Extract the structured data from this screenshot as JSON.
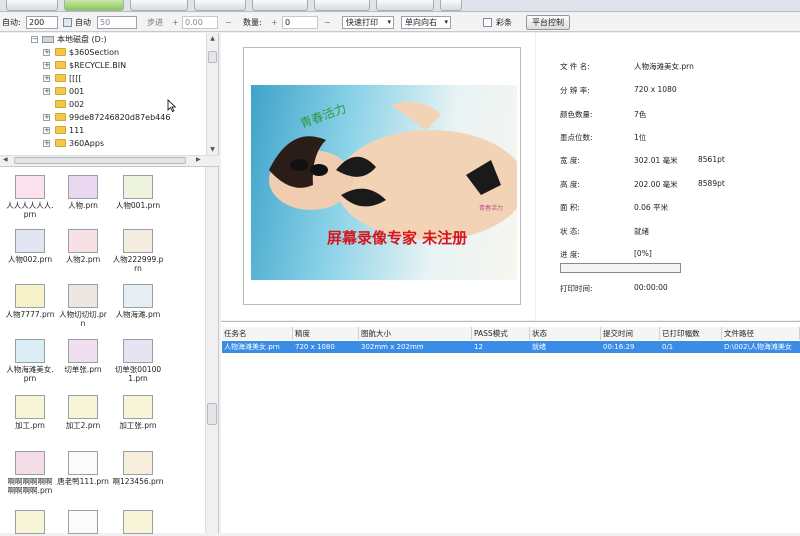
{
  "options": {
    "auto_label": "自动:",
    "auto_value": "200",
    "auto2_label": "自动",
    "auto2_value": "50",
    "spacing_label": "步进",
    "spacing_value": "0.00",
    "copies_label": "数量:",
    "copies_value": "0",
    "speed_select": "快速打印",
    "direction_select": "单向向右",
    "color_label": "彩条",
    "platform_button": "平台控制"
  },
  "tree": {
    "drive": "本地磁盘 (D:)",
    "folders": [
      "$360Section",
      "$RECYCLE.BIN",
      "[[[[",
      "001",
      "002",
      "99de87246820d87eb446",
      "111",
      "360Apps"
    ]
  },
  "files": [
    "人人人人人人.prn",
    "人物.prn",
    "人物001.prn",
    "人物002.prn",
    "人物2.prn",
    "人物222999.prn",
    "人物7777.prn",
    "人物切切切.prn",
    "人物海滩.prn",
    "人物海滩美女.prn",
    "切单张.prn",
    "切单张001001.prn",
    "加工.prn",
    "加工2.prn",
    "加工张.prn",
    "啊啊啊啊啊啊啊啊啊啊.prn",
    "唐老鸭111.prn",
    "啊123456.prn",
    "",
    "",
    ""
  ],
  "preview": {
    "watermark": "屏幕录像专家 未注册",
    "photo_text": "青春活力",
    "photo_stamp": "青春活力"
  },
  "properties": {
    "filename_label": "文 件 名:",
    "filename": "人物海滩美女.prn",
    "resolution_label": "分 辨 率:",
    "resolution": "720 x 1080",
    "colors_label": "颜色数量:",
    "colors": "7色",
    "dot_label": "墨点位数:",
    "dot": "1位",
    "width_label": "宽    度:",
    "width_mm": "302.01 毫米",
    "width_pt": "8561pt",
    "height_label": "高    度:",
    "height_mm": "202.00 毫米",
    "height_pt": "8589pt",
    "area_label": "面    积:",
    "area": "0.06 平米",
    "status_label": "状    态:",
    "status": "就绪",
    "progress_label": "进    度:",
    "progress": "[0%]",
    "progress_fraction": 0,
    "time_label": "打印时间:",
    "time": "00:00:00"
  },
  "table": {
    "headers": [
      "任务名",
      "精度",
      "图航大小",
      "PASS模式",
      "状态",
      "提交时间",
      "已打印幅数",
      "文件路径"
    ],
    "rows": [
      [
        "人物海滩美女.prn",
        "720 x 1080",
        "302mm x 202mm",
        "12",
        "就绪",
        "00:16:29",
        "0/1",
        "D:\\002\\人物海滩美女"
      ]
    ]
  },
  "colors": {
    "accent": "#3b8ce6",
    "watermark": "#d6161b"
  }
}
